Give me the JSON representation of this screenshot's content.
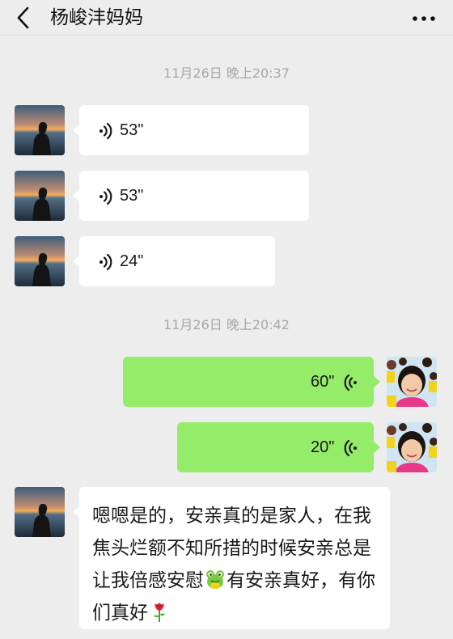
{
  "header": {
    "title": "杨峻沣妈妈",
    "back_icon": "chevron-left-icon",
    "more_icon": "more-dots-icon"
  },
  "timestamps": [
    "11月26日 晚上20:37",
    "11月26日 晚上20:42"
  ],
  "messages": [
    {
      "side": "left",
      "type": "voice",
      "duration": "53\""
    },
    {
      "side": "left",
      "type": "voice",
      "duration": "53\""
    },
    {
      "side": "left",
      "type": "voice",
      "duration": "24\""
    },
    {
      "side": "right",
      "type": "voice",
      "duration": "60\""
    },
    {
      "side": "right",
      "type": "voice",
      "duration": "20\""
    },
    {
      "side": "left",
      "type": "text",
      "text_part1": "嗯嗯是的，安亲真的是家人，在我焦头烂额不知所措的时候安亲总是让我倍感安慰",
      "emoji1": "frog-emoji",
      "text_part2": "有安亲真好，有你们真好",
      "emoji2": "rose-emoji"
    }
  ],
  "colors": {
    "background": "#ededed",
    "incoming_bubble": "#ffffff",
    "outgoing_bubble": "#95ec69",
    "timestamp": "#a8a8a8"
  }
}
